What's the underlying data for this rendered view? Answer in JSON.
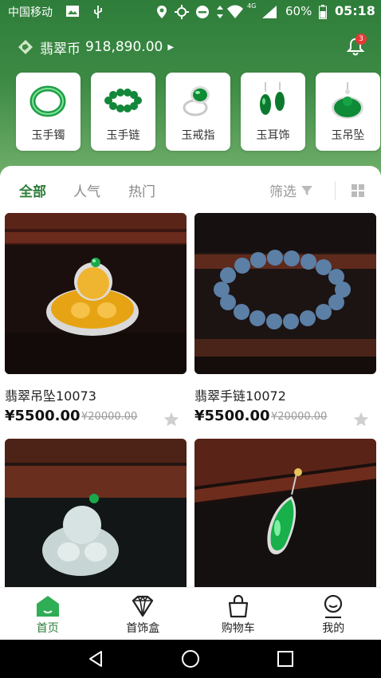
{
  "status_bar": {
    "carrier": "中国移动",
    "network": "4G",
    "battery": "60%",
    "time": "05:18"
  },
  "header": {
    "coin_label": "翡翠币",
    "coin_value": "918,890.00",
    "notification_count": "3"
  },
  "categories": [
    {
      "label": "玉手镯",
      "icon": "bangle-icon"
    },
    {
      "label": "玉手链",
      "icon": "bead-bracelet-icon"
    },
    {
      "label": "玉戒指",
      "icon": "ring-icon"
    },
    {
      "label": "玉耳饰",
      "icon": "earring-icon"
    },
    {
      "label": "玉吊坠",
      "icon": "pendant-icon"
    }
  ],
  "filters": {
    "tabs": [
      "全部",
      "人气",
      "热门"
    ],
    "active_tab": "全部",
    "filter_label": "筛选"
  },
  "products": [
    {
      "name": "翡翠吊坠10073",
      "price": "¥5500.00",
      "original_price": "¥20000.00"
    },
    {
      "name": "翡翠手链10072",
      "price": "¥5500.00",
      "original_price": "¥20000.00"
    },
    {
      "name": "",
      "price": "",
      "original_price": ""
    },
    {
      "name": "",
      "price": "",
      "original_price": ""
    }
  ],
  "bottom_nav": [
    {
      "label": "首页",
      "icon": "home-icon",
      "active": true
    },
    {
      "label": "首饰盒",
      "icon": "jewelry-box-icon",
      "active": false
    },
    {
      "label": "购物车",
      "icon": "shopping-bag-icon",
      "active": false
    },
    {
      "label": "我的",
      "icon": "profile-icon",
      "active": false
    }
  ],
  "colors": {
    "brand_green": "#2e7d3a",
    "header_gradient_end": "#6fae6a",
    "badge_red": "#e53935"
  }
}
